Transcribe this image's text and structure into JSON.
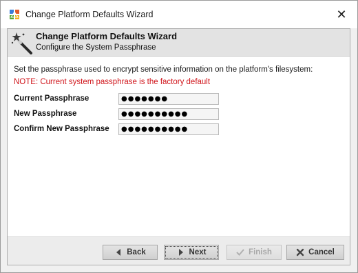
{
  "window": {
    "title": "Change Platform Defaults Wizard",
    "close_glyph": "✕"
  },
  "header": {
    "title": "Change Platform Defaults Wizard",
    "subtitle": "Configure the System Passphrase",
    "icon": "magic-wand-icon"
  },
  "body": {
    "instruction": "Set the passphrase used to encrypt sensitive information on the platform's filesystem:",
    "note": "NOTE: Current system passphrase is the factory default",
    "note_color": "#d0151b"
  },
  "fields": [
    {
      "label": "Current Passphrase",
      "value": "●●●●●●●"
    },
    {
      "label": "New Passphrase",
      "value": "●●●●●●●●●●"
    },
    {
      "label": "Confirm New Passphrase",
      "value": "●●●●●●●●●●"
    }
  ],
  "buttons": {
    "back": {
      "label": "Back",
      "icon": "arrow-left-icon",
      "enabled": true
    },
    "next": {
      "label": "Next",
      "icon": "arrow-right-icon",
      "enabled": true
    },
    "finish": {
      "label": "Finish",
      "icon": "check-icon",
      "enabled": false
    },
    "cancel": {
      "label": "Cancel",
      "icon": "x-icon",
      "enabled": true
    }
  }
}
